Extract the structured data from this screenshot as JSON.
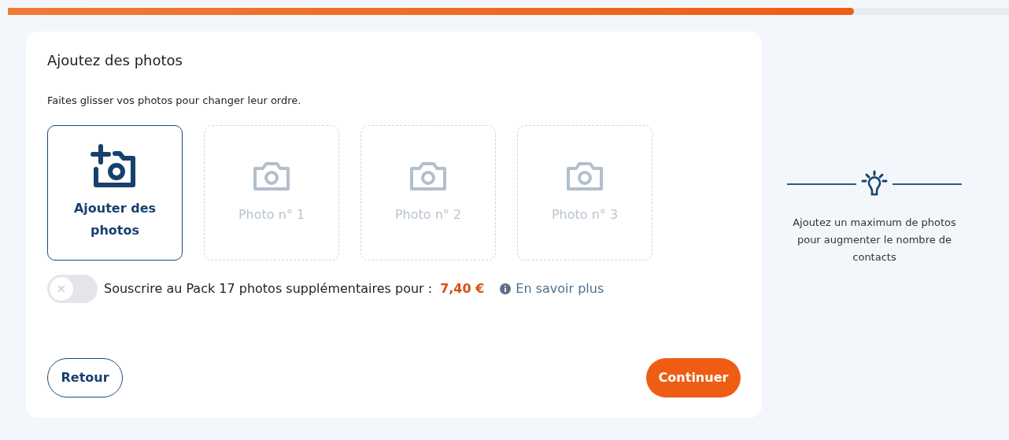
{
  "progress": {
    "level": 0.845
  },
  "title": "Ajoutez des photos",
  "hint": "Faites glisser vos photos pour changer leur ordre.",
  "add_tile": {
    "label": "Ajouter des photos"
  },
  "photo_slots": [
    {
      "label": "Photo n° 1"
    },
    {
      "label": "Photo n° 2"
    },
    {
      "label": "Photo n° 3"
    }
  ],
  "pack": {
    "on": false,
    "label": "Souscrire au Pack 17 photos supplémentaires pour :",
    "price": "7,40 €",
    "link": "En savoir plus"
  },
  "buttons": {
    "back": "Retour",
    "next": "Continuer"
  },
  "tip": {
    "text": "Ajoutez un maximum de photos pour augmenter le nombre de contacts"
  }
}
